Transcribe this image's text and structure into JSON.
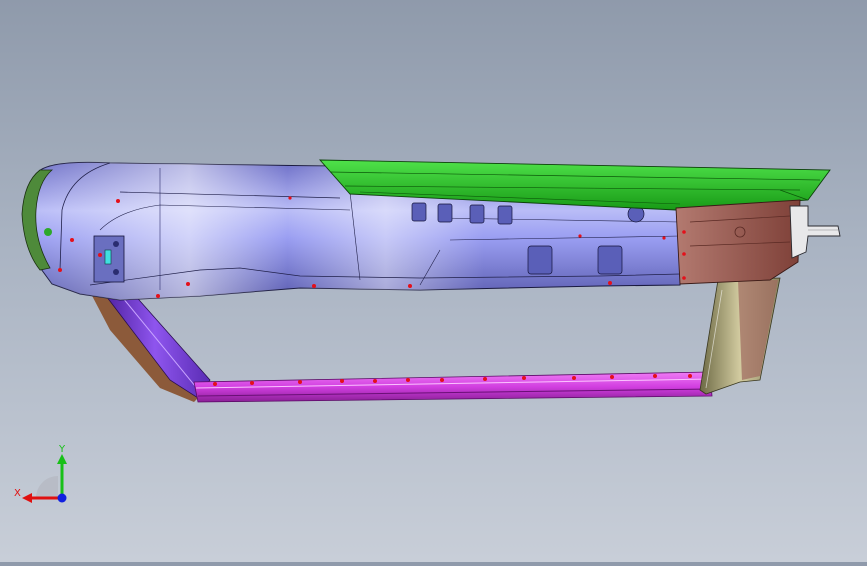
{
  "viewport": {
    "background_top": "#8f9aab",
    "background_bottom": "#c8ced8"
  },
  "model": {
    "parts": [
      {
        "name": "housing",
        "color": "#8a8ef0"
      },
      {
        "name": "top-cover",
        "color": "#22c91e"
      },
      {
        "name": "end-cap",
        "color": "#9a5a52"
      },
      {
        "name": "bottom-rail",
        "color": "#d13ee0"
      },
      {
        "name": "left-strut",
        "color": "#7b3ed8"
      },
      {
        "name": "right-strut",
        "color": "#c9c08a"
      },
      {
        "name": "bracket",
        "color": "#e8e8ea"
      }
    ]
  },
  "triad": {
    "x_label": "X",
    "y_label": "Y",
    "x_color": "#e01010",
    "y_color": "#18c018",
    "z_color": "#1020e0"
  }
}
